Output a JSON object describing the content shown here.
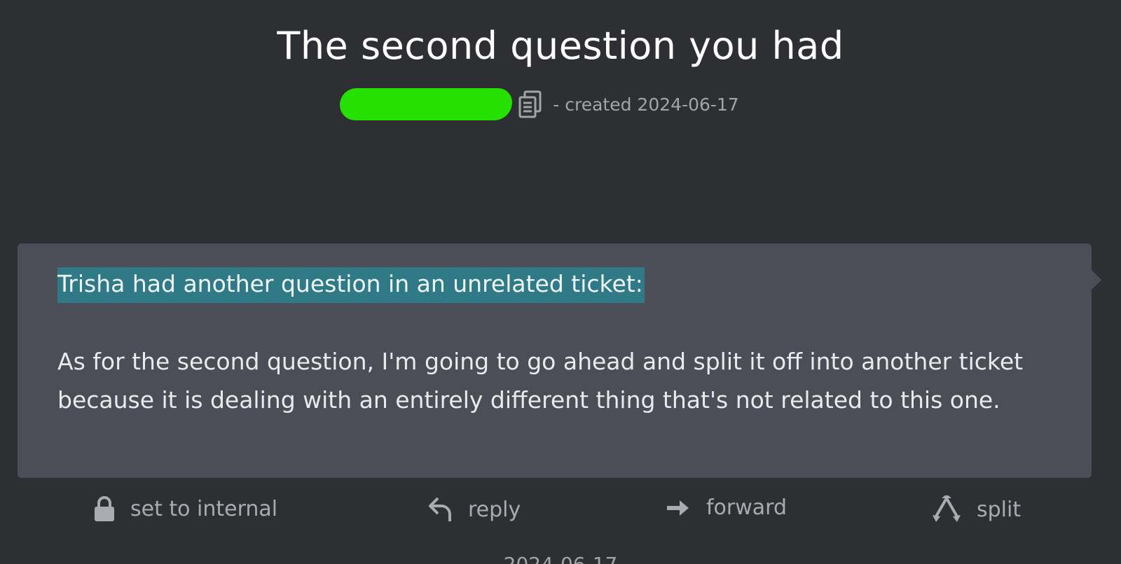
{
  "ticket": {
    "title": "The second question you had",
    "created": "- created 2024-06-17"
  },
  "article": {
    "highlighted_line": "Trisha had another question in an unrelated ticket:",
    "body": "As for the second question, I'm going to go ahead and split it off into another ticket because it is dealing with an entirely different thing that's not related to this one."
  },
  "actions": {
    "internal_label": "set to internal",
    "reply_label": "reply",
    "forward_label": "forward",
    "split_label": "split"
  },
  "next_date": "2024-06-17",
  "colors": {
    "background": "#2e2f33",
    "article_bg": "#4b4e56",
    "highlight": "#2f7a86",
    "redaction": "#25e000"
  },
  "icons": [
    "copy-icon",
    "lock-icon",
    "reply-icon",
    "forward-icon",
    "split-icon"
  ]
}
